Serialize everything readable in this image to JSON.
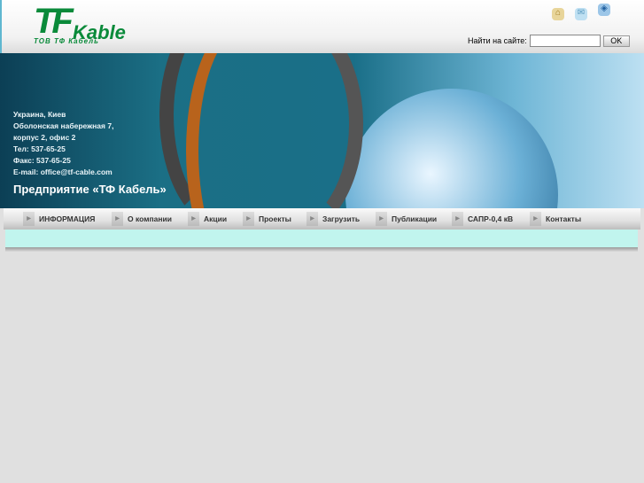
{
  "logo": {
    "brand_tf": "TF",
    "brand_kable": "Kable",
    "subtitle": "ТОВ ТФ Кабель"
  },
  "search": {
    "label": "Найти на сайте:",
    "value": "",
    "ok": "OK"
  },
  "icons": [
    "home-icon",
    "mail-icon",
    "sitemap-icon"
  ],
  "address": [
    "Украина, Киев",
    "Оболонская набережная 7,",
    "корпус 2, офис 2",
    "Тел: 537-65-25",
    "Факс: 537-65-25",
    "E-mail: office@tf-cable.com"
  ],
  "slogan": "Предприятие «ТФ Кабель»",
  "nav": [
    "ИНФОРМАЦИЯ",
    "О компании",
    "Акции",
    "Проекты",
    "Загрузить",
    "Публикации",
    "САПР-0,4 кВ",
    "Контакты"
  ]
}
